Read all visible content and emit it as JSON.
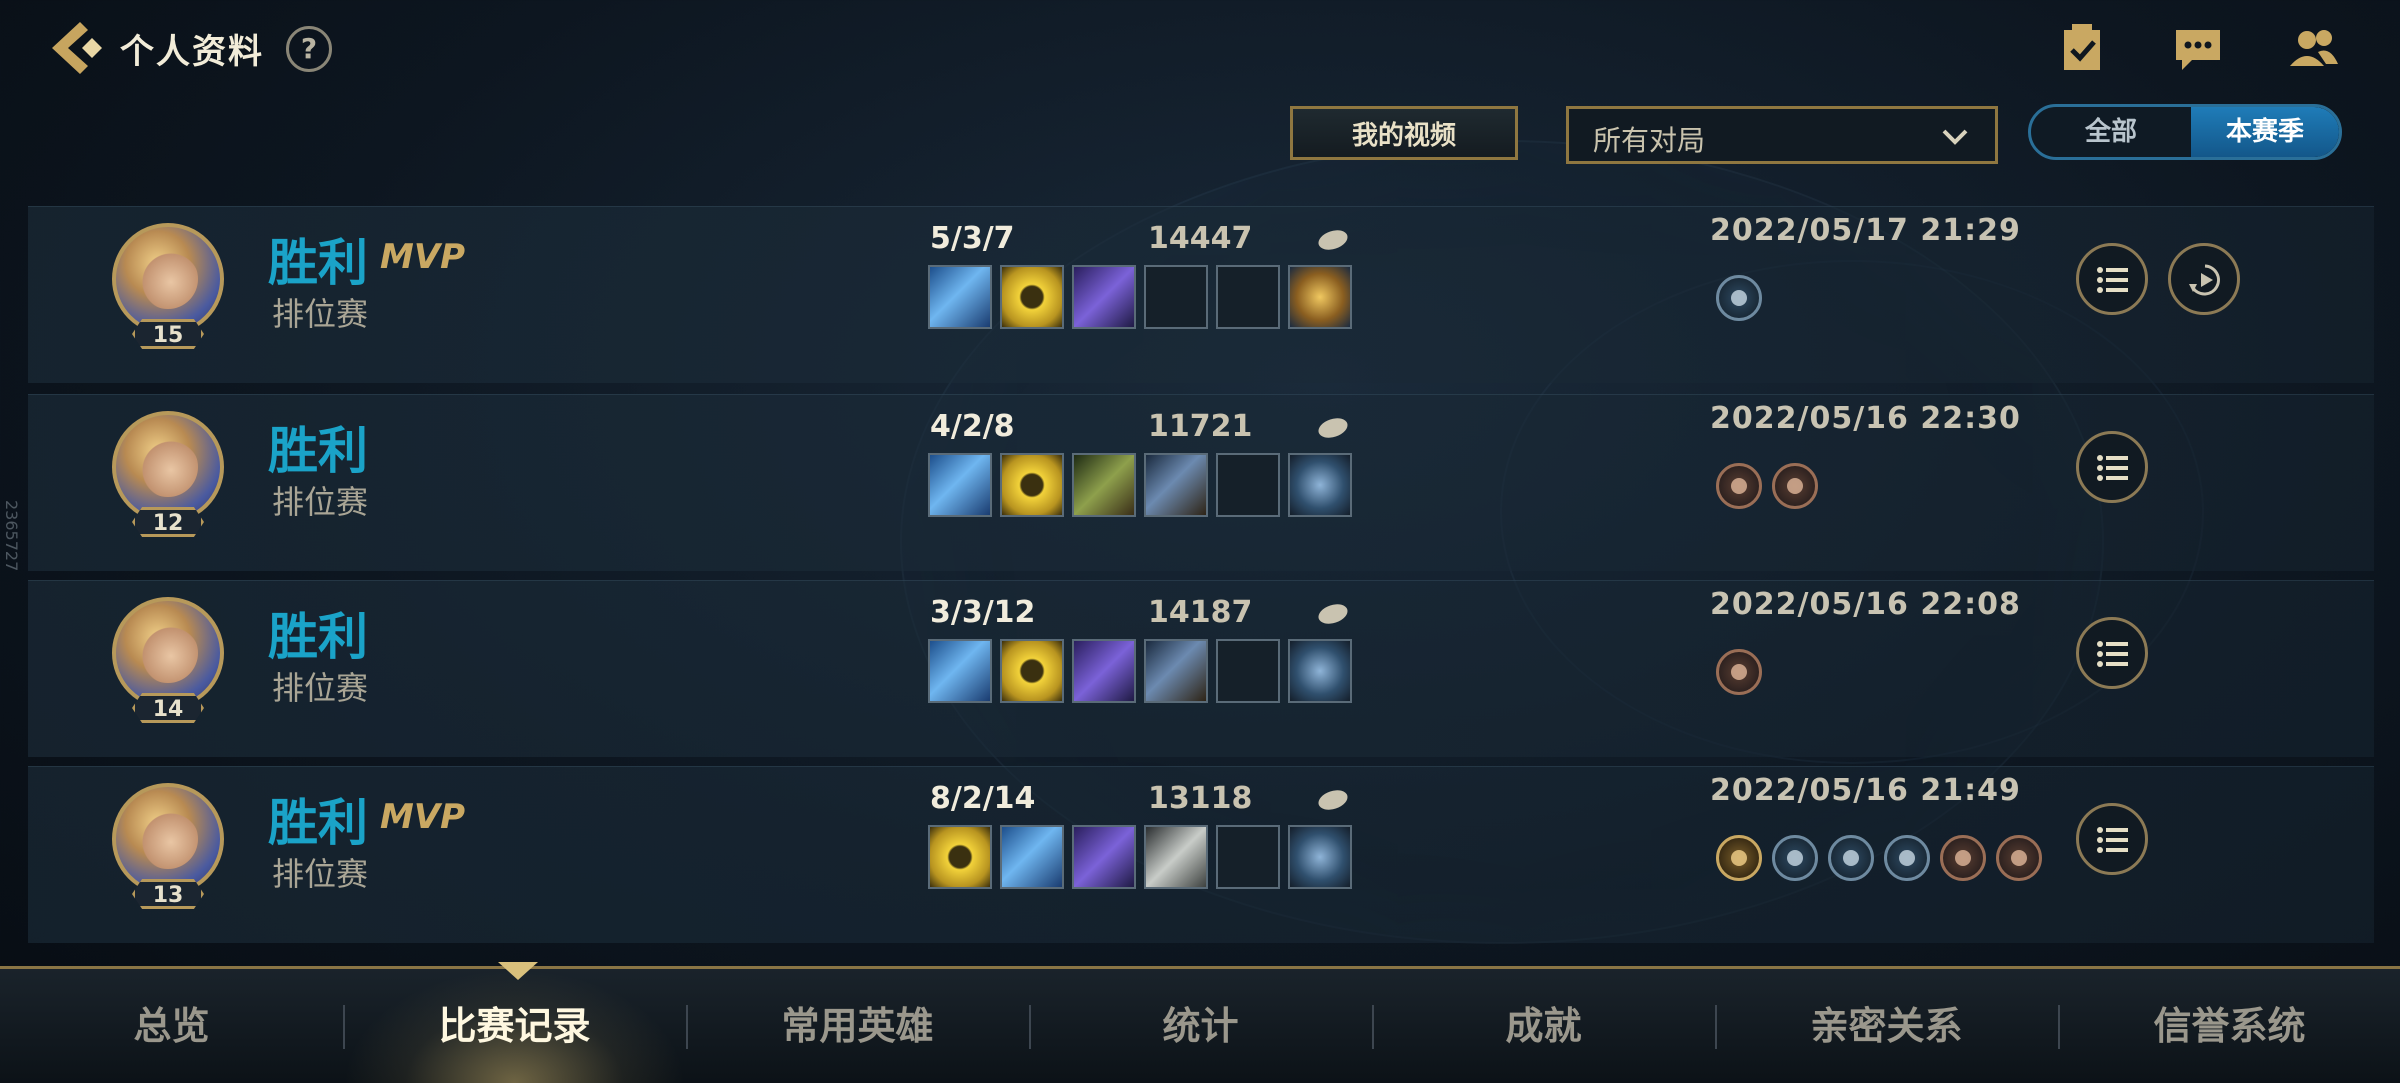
{
  "header": {
    "title": "个人资料",
    "help": "?"
  },
  "controls": {
    "video_label": "我的视频",
    "match_filter": "所有对局",
    "toggle_all": "全部",
    "toggle_season": "本赛季"
  },
  "side_id": "2365727",
  "matches": [
    {
      "result": "胜利",
      "mvp": "MVP",
      "mode": "排位赛",
      "level": "15",
      "kda": "5/3/7",
      "gold": "14447",
      "date": "2022/05/17 21:29",
      "items": [
        "blue-blade",
        "gold-triangle",
        "purple-blade",
        "empty",
        "empty",
        "gold-trinket"
      ],
      "medals": [
        "blue"
      ]
    },
    {
      "result": "胜利",
      "mvp": "",
      "mode": "排位赛",
      "level": "12",
      "kda": "4/2/8",
      "gold": "11721",
      "date": "2022/05/16 22:30",
      "items": [
        "blue-blade",
        "gold-triangle",
        "green-dagger",
        "bow",
        "empty",
        "blue-trinket"
      ],
      "medals": [
        "bronze",
        "bronze"
      ]
    },
    {
      "result": "胜利",
      "mvp": "",
      "mode": "排位赛",
      "level": "14",
      "kda": "3/3/12",
      "gold": "14187",
      "date": "2022/05/16 22:08",
      "items": [
        "blue-blade",
        "gold-triangle",
        "purple-blade",
        "bow",
        "empty",
        "blue-trinket"
      ],
      "medals": [
        "bronze"
      ]
    },
    {
      "result": "胜利",
      "mvp": "MVP",
      "mode": "排位赛",
      "level": "13",
      "kda": "8/2/14",
      "gold": "13118",
      "date": "2022/05/16 21:49",
      "items": [
        "gold-triangle",
        "blue-blade",
        "purple-blade",
        "silver-blade",
        "empty",
        "blue-trinket"
      ],
      "medals": [
        "gold",
        "blue",
        "blue",
        "blue",
        "bronze",
        "bronze"
      ]
    }
  ],
  "nav": {
    "tabs": [
      "总览",
      "比赛记录",
      "常用英雄",
      "统计",
      "成就",
      "亲密关系",
      "信誉系统"
    ],
    "active_index": 1
  },
  "colors": {
    "win": "#1aa3c8",
    "accent_gold": "#b7995a",
    "toggle_active": "#1f7cb8"
  }
}
